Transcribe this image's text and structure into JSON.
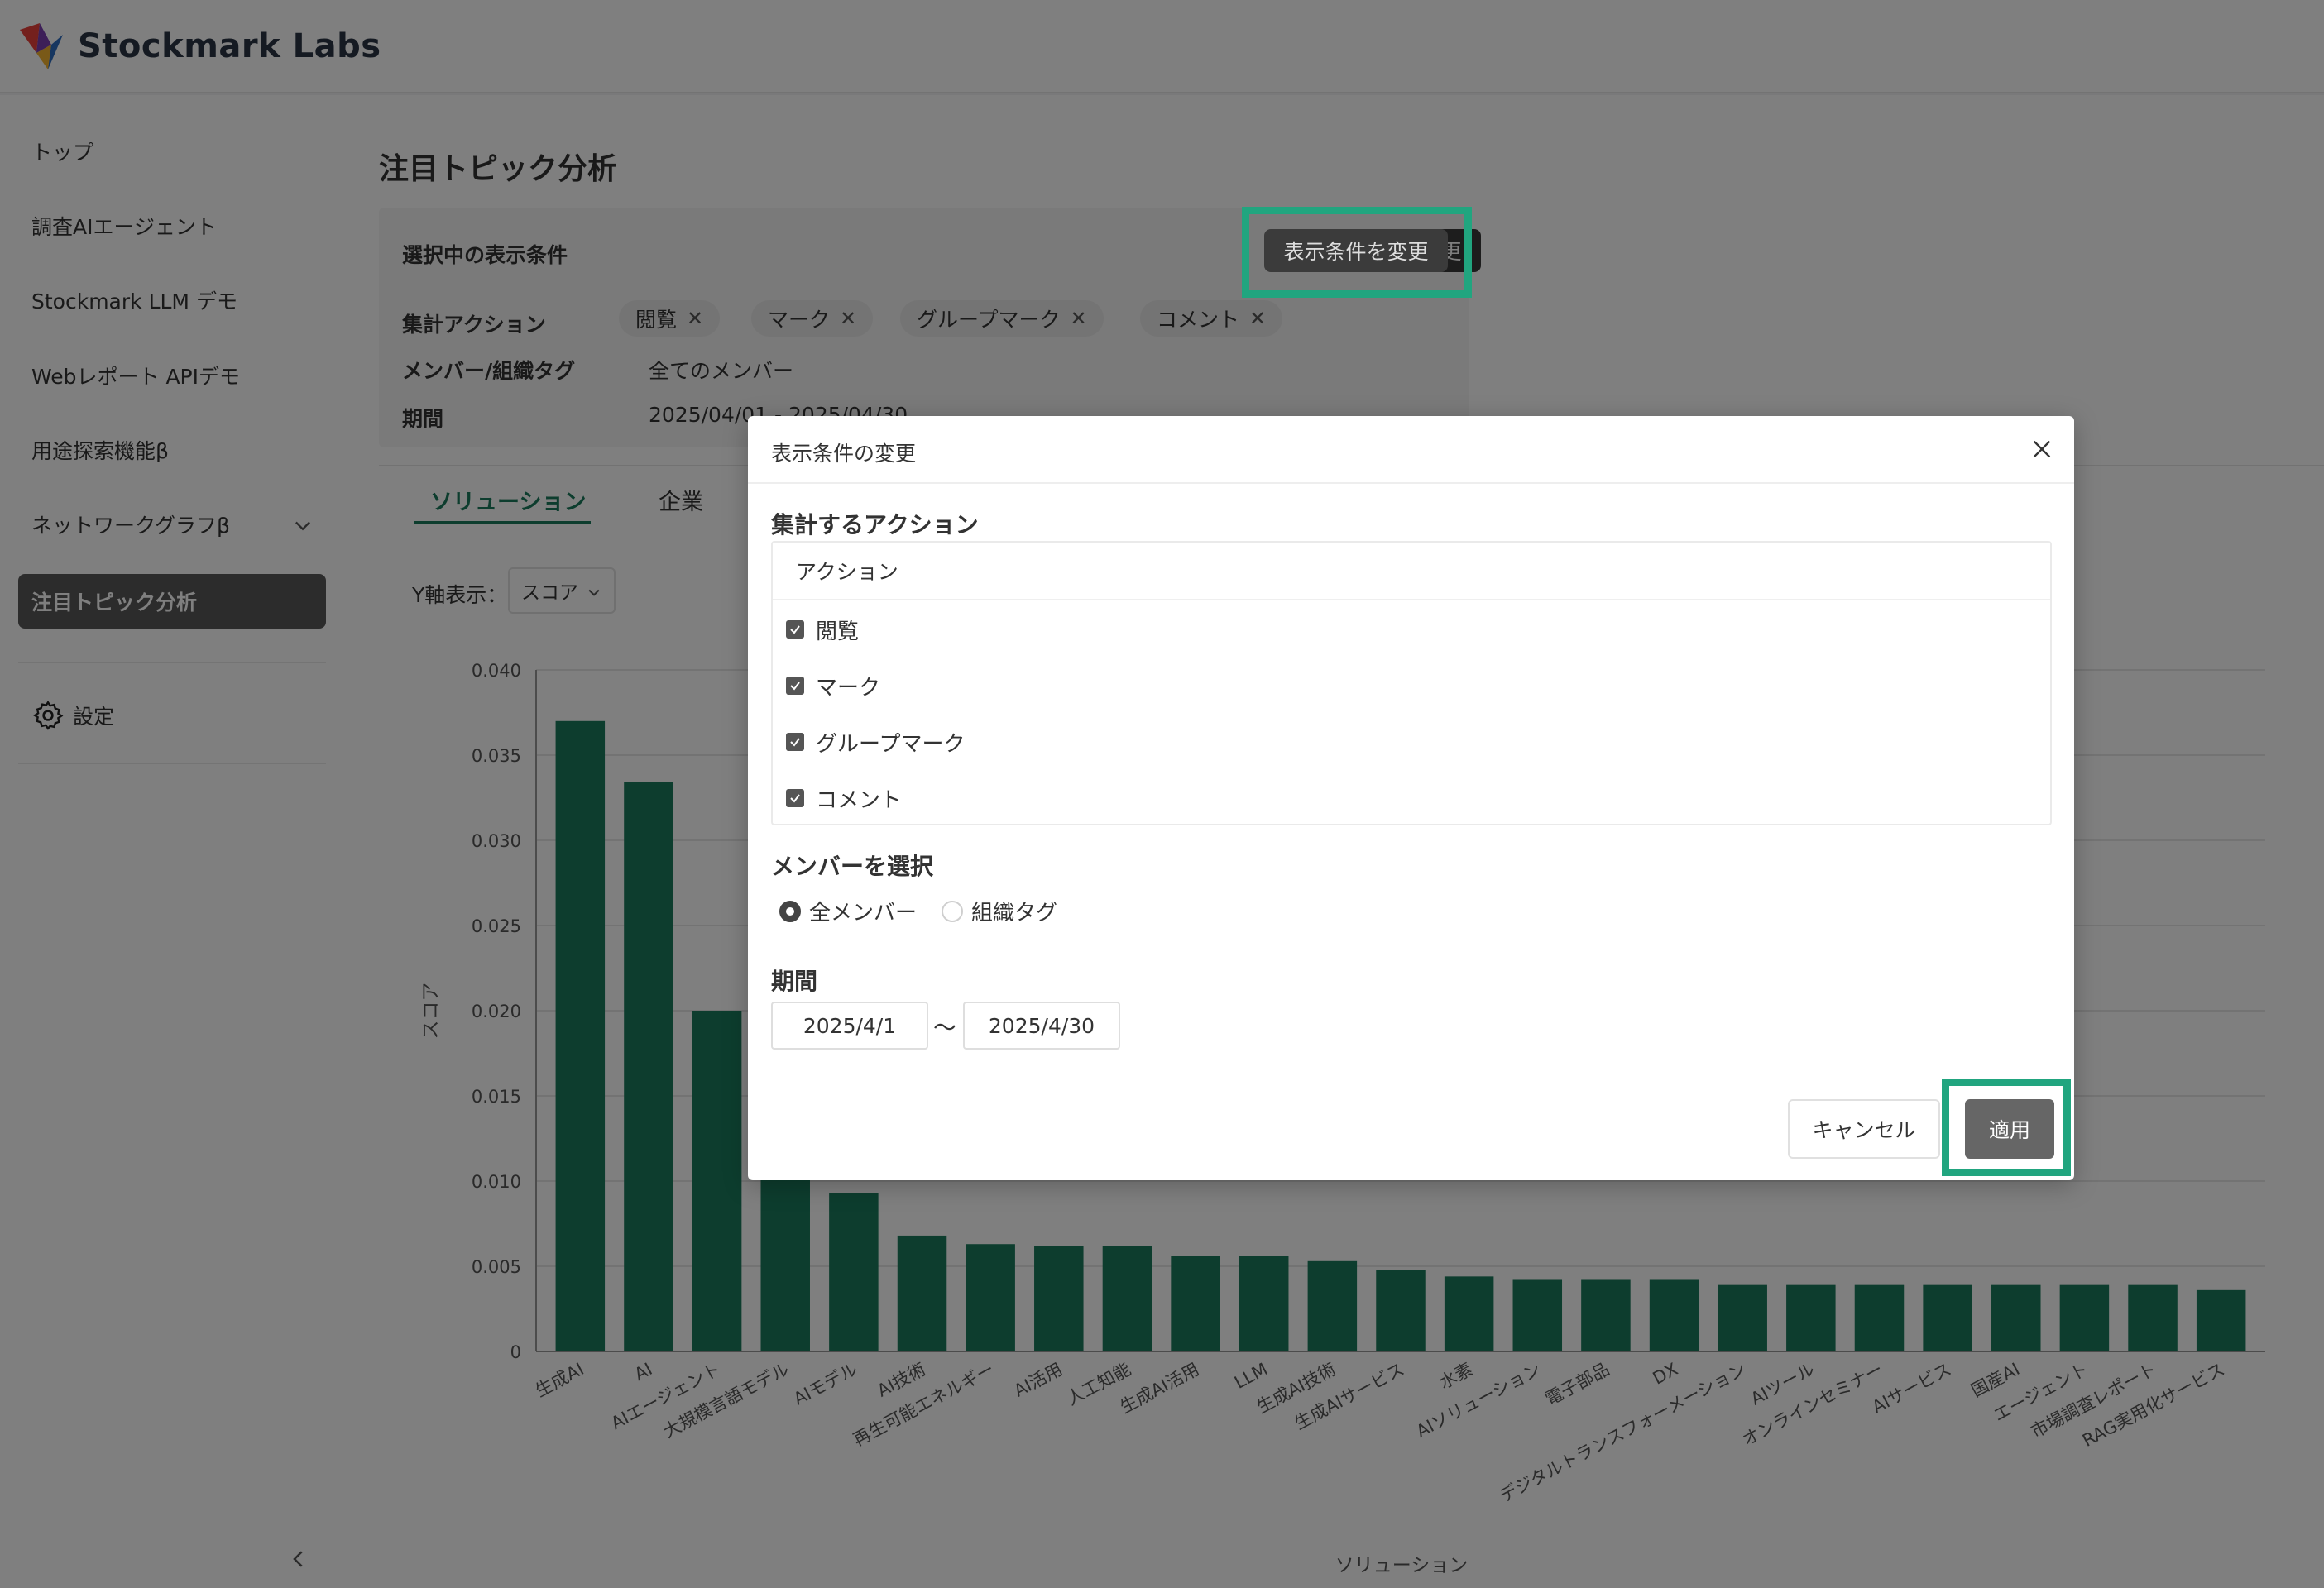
{
  "app": {
    "title": "Stockmark Labs"
  },
  "sidebar": {
    "items": [
      {
        "label": "トップ"
      },
      {
        "label": "調査AIエージェント"
      },
      {
        "label": "Stockmark LLM デモ"
      },
      {
        "label": "Webレポート APIデモ"
      },
      {
        "label": "用途探索機能β"
      },
      {
        "label": "ネットワークグラフβ"
      },
      {
        "label": "注目トピック分析"
      }
    ],
    "settings_label": "設定"
  },
  "page": {
    "title": "注目トピック分析",
    "conditions": {
      "heading": "選択中の表示条件",
      "change_button": "表示条件を変更",
      "action_label": "集計アクション",
      "action_chips": [
        "閲覧",
        "マーク",
        "グループマーク",
        "コメント"
      ],
      "member_label": "メンバー/組織タグ",
      "member_value": "全てのメンバー",
      "period_label": "期間",
      "period_value": "2025/04/01 - 2025/04/30"
    },
    "tabs": [
      "ソリューション",
      "企業"
    ],
    "yaxis_label": "Y軸表示：",
    "yaxis_value": "スコア"
  },
  "chart_data": {
    "type": "bar",
    "categories": [
      "生成AI",
      "AI",
      "AIエージェント",
      "大規模言語モデル",
      "AIモデル",
      "AI技術",
      "再生可能エネルギー",
      "AI活用",
      "人工知能",
      "生成AI活用",
      "LLM",
      "生成AI技術",
      "生成AIサービス",
      "水素",
      "AIソリューション",
      "電子部品",
      "DX",
      "デジタルトランスフォーメーション",
      "AIツール",
      "オンラインセミナー",
      "AIサービス",
      "国産AI",
      "エージェント",
      "市場調査レポート",
      "RAG実用化サービス"
    ],
    "values": [
      0.037,
      0.0334,
      0.02,
      0.012,
      0.0093,
      0.0068,
      0.0063,
      0.0062,
      0.0062,
      0.0056,
      0.0056,
      0.0053,
      0.0048,
      0.0044,
      0.0042,
      0.0042,
      0.0042,
      0.0039,
      0.0039,
      0.0039,
      0.0039,
      0.0039,
      0.0039,
      0.0039,
      0.0036
    ],
    "yticks": [
      "0",
      "0.005",
      "0.010",
      "0.015",
      "0.020",
      "0.025",
      "0.030",
      "0.035",
      "0.040"
    ],
    "xlabel": "ソリューション",
    "ylabel": "スコア",
    "ylim": [
      0,
      0.04
    ],
    "color": "#1a7a5c"
  },
  "modal": {
    "title": "表示条件の変更",
    "action_section": "集計するアクション",
    "action_header": "アクション",
    "actions": [
      "閲覧",
      "マーク",
      "グループマーク",
      "コメント"
    ],
    "member_section": "メンバーを選択",
    "member_options": [
      "全メンバー",
      "組織タグ"
    ],
    "period_section": "期間",
    "date_from": "2025/4/1",
    "date_separator": "〜",
    "date_to": "2025/4/30",
    "cancel_label": "キャンセル",
    "apply_label": "適用"
  },
  "colors": {
    "accent": "#1a7a5c",
    "highlight": "#21a57f"
  }
}
